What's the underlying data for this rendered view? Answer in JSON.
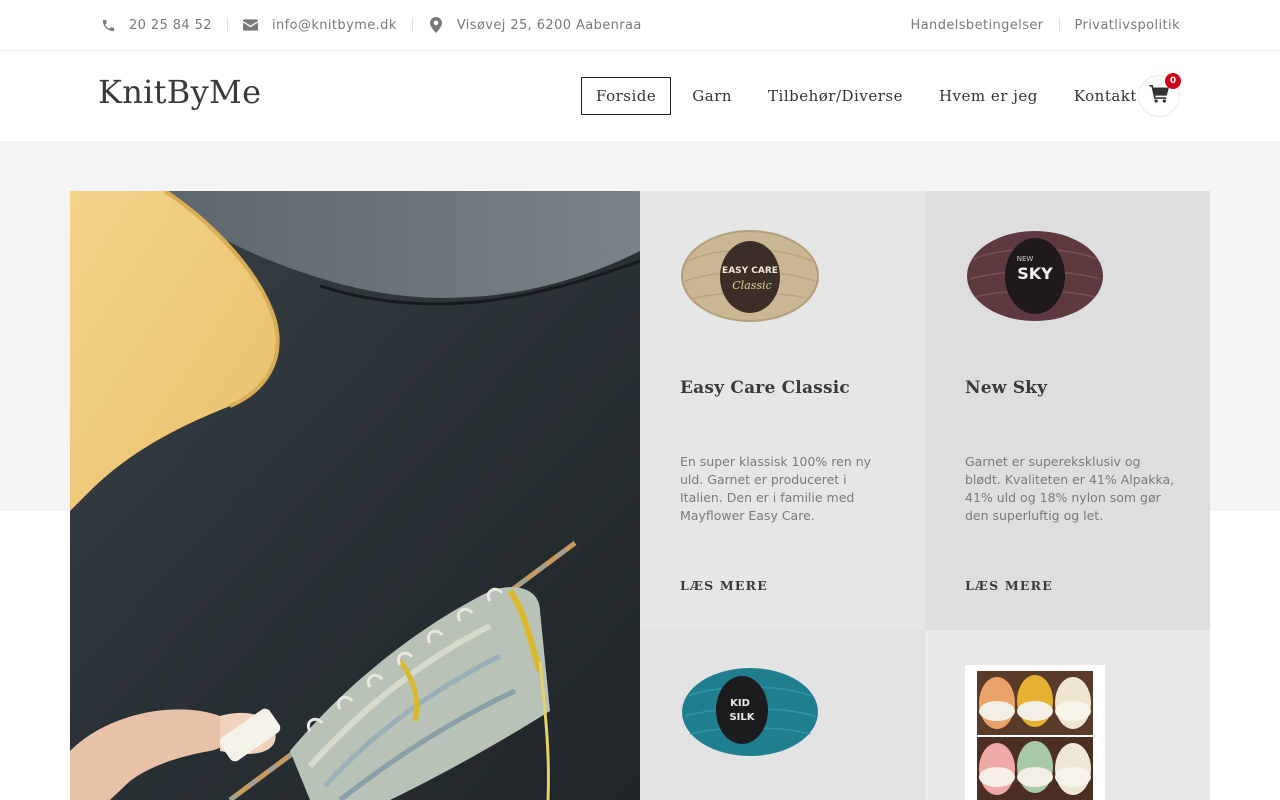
{
  "topbar": {
    "phone": "20 25 84 52",
    "email": "info@knitbyme.dk",
    "address": "Visøvej 25, 6200 Aabenraa",
    "links": [
      "Handelsbetingelser",
      "Privatlivspolitik"
    ]
  },
  "header": {
    "logo": "KnitByMe",
    "nav": [
      "Forside",
      "Garn",
      "Tilbehør/Diverse",
      "Hvem er jeg",
      "Kontakt"
    ],
    "active_nav": "Forside",
    "cart_count": "0"
  },
  "products": [
    {
      "title": "Easy Care Classic",
      "description": "En super klassisk 100% ren ny uld. Garnet er produceret i Italien. Den er i familie med Mayflower Easy Care.",
      "link": "LÆS MERE",
      "label_text": "EASY CARE",
      "label_sub": "Classic"
    },
    {
      "title": "New Sky",
      "description": "Garnet er supereksklusiv og blødt. Kvaliteten er 41% Alpakka, 41% uld og 18% nylon som gør den superluftig og let.",
      "link": "LÆS MERE",
      "label_text": "SKY",
      "label_sub": "NEW"
    },
    {
      "label_text": "KID",
      "label_sub": "SILK"
    },
    {}
  ],
  "colors": {
    "band": "#f4f4f4",
    "badge": "#d0021b",
    "card1": "#e6e6e6",
    "card2": "#dedede"
  }
}
